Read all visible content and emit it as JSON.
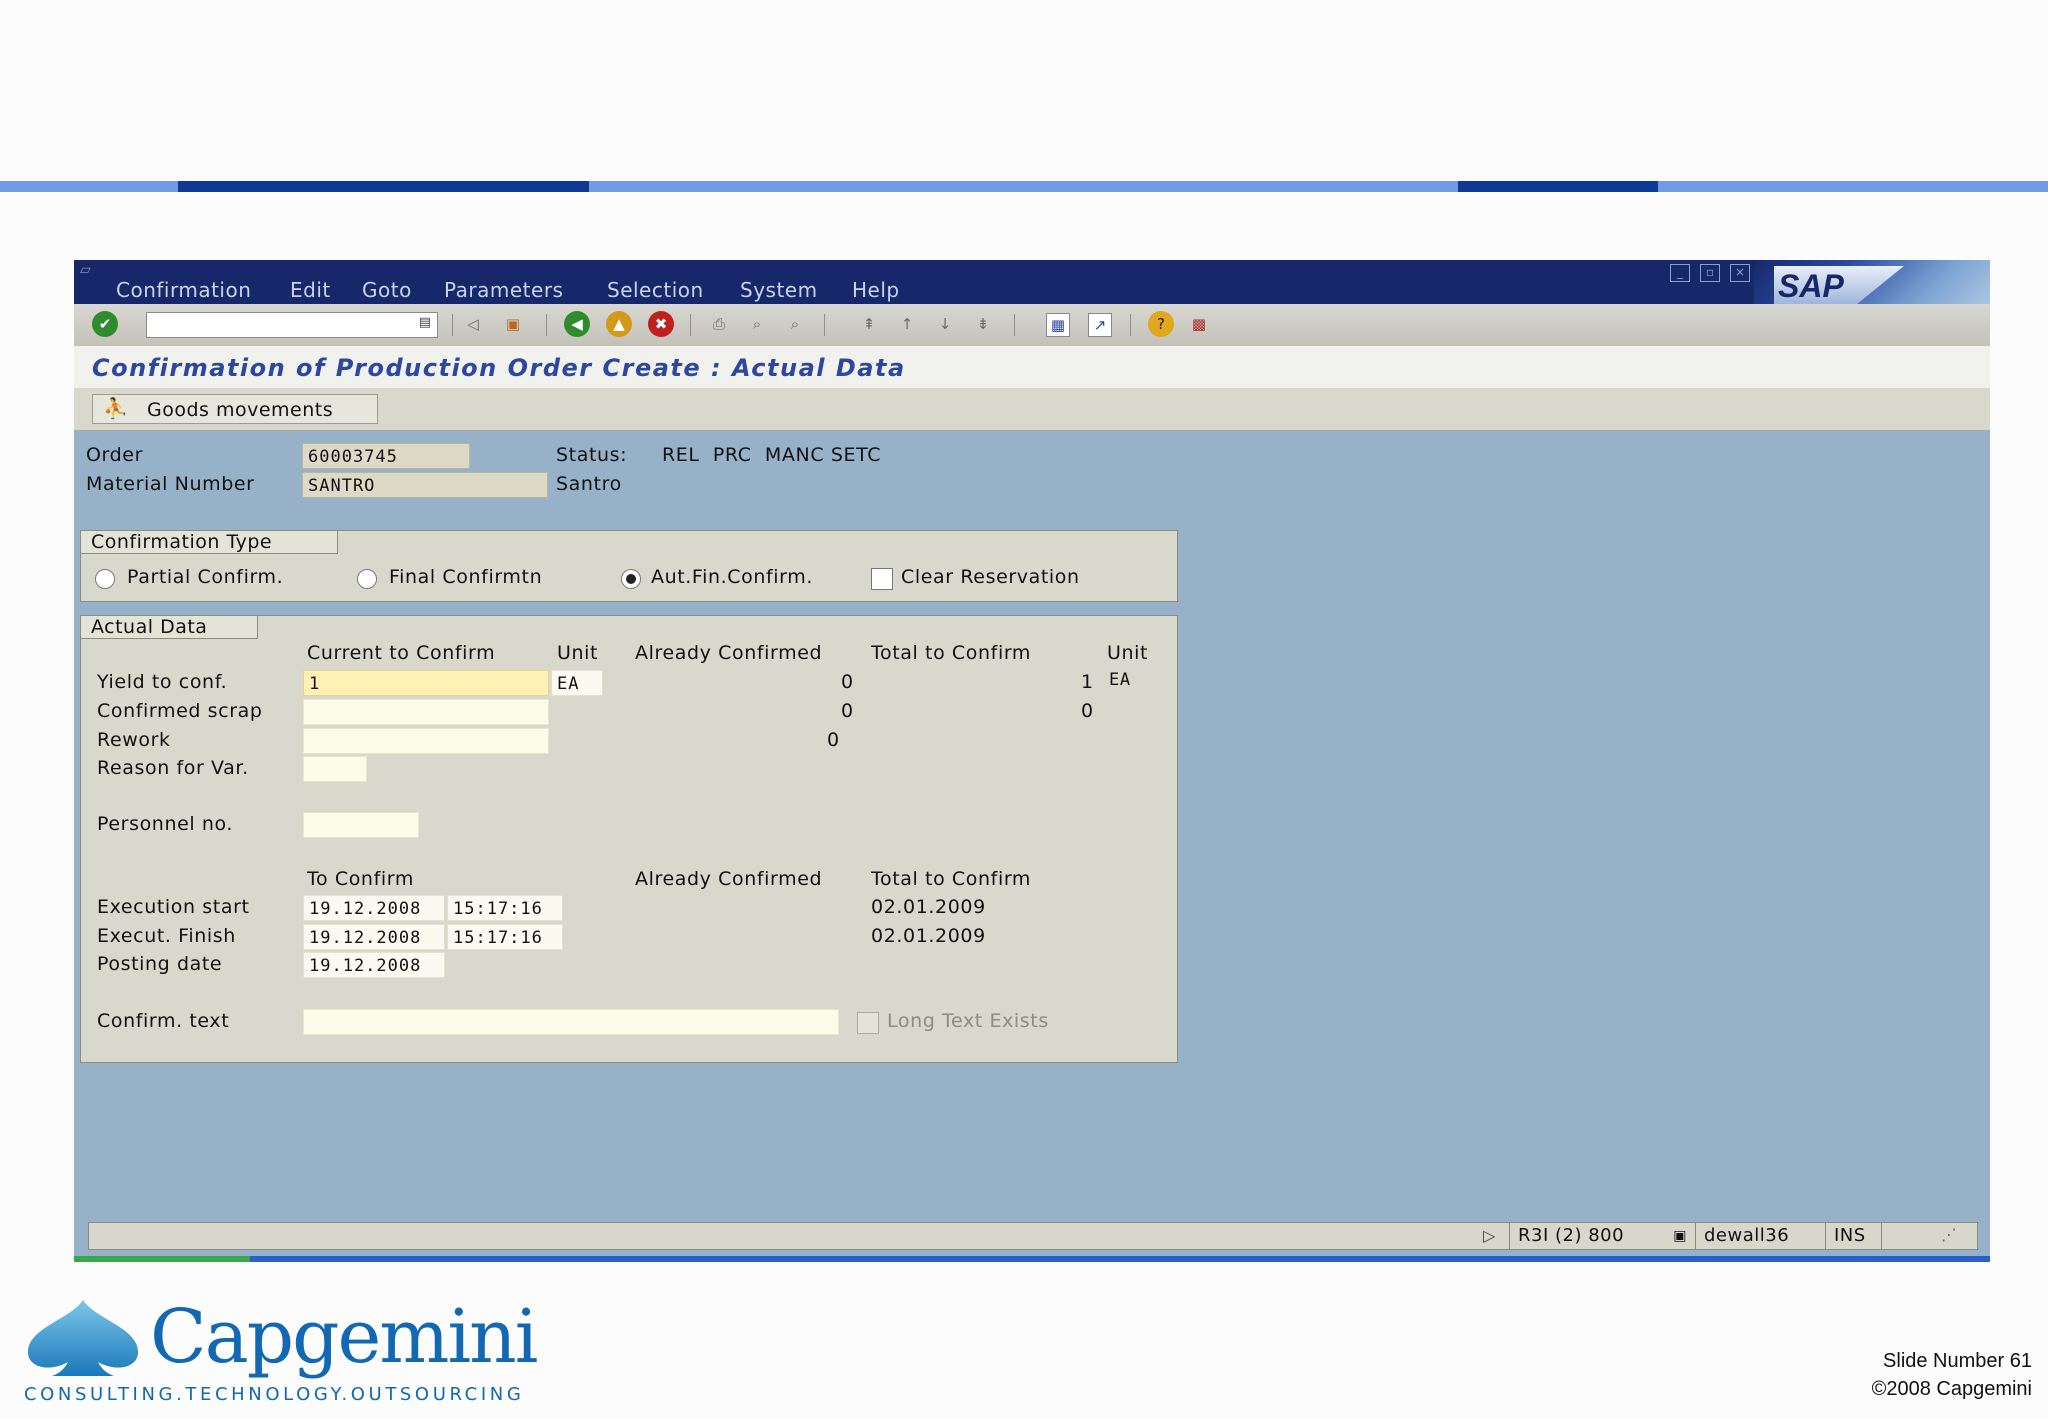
{
  "menu": [
    "Confirmation",
    "Edit",
    "Goto",
    "Parameters",
    "Selection",
    "System",
    "Help"
  ],
  "sap_logo": "SAP",
  "title": "Confirmation of Production Order Create : Actual Data",
  "app_toolbar": {
    "goods_movements": "Goods movements"
  },
  "header": {
    "order_label": "Order",
    "order_value": "60003745",
    "status_label": "Status:",
    "status_value": "REL  PRC  MANC SETC",
    "material_label": "Material Number",
    "material_value": "SANTRO",
    "material_desc": "Santro"
  },
  "confirmation_type": {
    "title": "Confirmation Type",
    "options": [
      "Partial Confirm.",
      "Final Confirmtn",
      "Aut.Fin.Confirm."
    ],
    "selected": "Aut.Fin.Confirm.",
    "clear_reservation": "Clear Reservation"
  },
  "actual_data": {
    "title": "Actual Data",
    "columns": {
      "current": "Current to Confirm",
      "unit": "Unit",
      "already": "Already Confirmed",
      "total": "Total to Confirm",
      "unit2": "Unit"
    },
    "rows": {
      "yield": {
        "label": "Yield to conf.",
        "current": "1",
        "unit": "EA",
        "already": "0",
        "total": "1",
        "unit2": "EA"
      },
      "scrap": {
        "label": "Confirmed scrap",
        "current": "",
        "already": "0",
        "total": "0"
      },
      "rework": {
        "label": "Rework",
        "current": "",
        "already": "0"
      },
      "reason": {
        "label": "Reason for Var.",
        "current": ""
      }
    },
    "personnel": {
      "label": "Personnel no.",
      "value": ""
    },
    "dates_columns": {
      "to_confirm": "To Confirm",
      "already": "Already Confirmed",
      "total": "Total to Confirm"
    },
    "exec_start": {
      "label": "Execution start",
      "date": "19.12.2008",
      "time": "15:17:16",
      "total": "02.01.2009"
    },
    "exec_finish": {
      "label": "Execut. Finish",
      "date": "19.12.2008",
      "time": "15:17:16",
      "total": "02.01.2009"
    },
    "posting": {
      "label": "Posting date",
      "date": "19.12.2008"
    },
    "confirm_text": {
      "label": "Confirm. text",
      "value": ""
    },
    "long_text": "Long Text Exists"
  },
  "statusbar": {
    "system": "R3I (2) 800",
    "user": "dewall36",
    "mode": "INS"
  },
  "footer": {
    "brand": "Capgemini",
    "tagline": "CONSULTING.TECHNOLOGY.OUTSOURCING",
    "slide_number": "Slide Number 61",
    "copyright": "©2008 Capgemini"
  }
}
